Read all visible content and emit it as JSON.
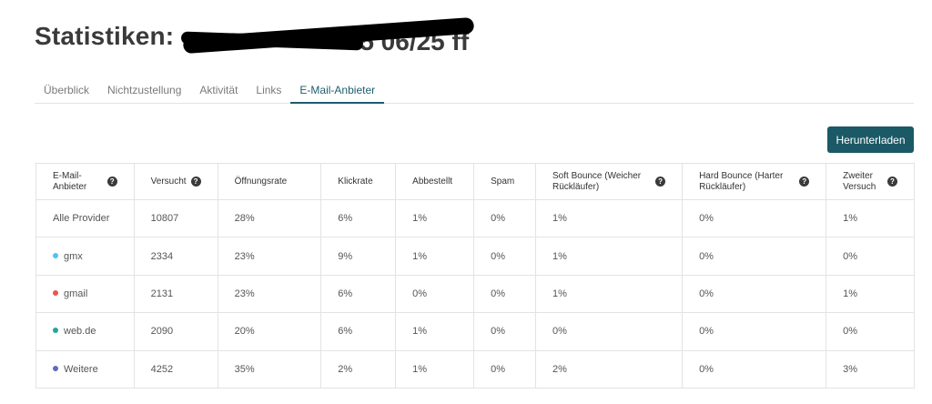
{
  "page": {
    "title": "Statistiken:",
    "title_redacted_tail": "",
    "redacted_visible": "5 06/25 ff"
  },
  "tabs": [
    {
      "label": "Überblick",
      "active": false
    },
    {
      "label": "Nichtzustellung",
      "active": false
    },
    {
      "label": "Aktivität",
      "active": false
    },
    {
      "label": "Links",
      "active": false
    },
    {
      "label": "E-Mail-Anbieter",
      "active": true
    }
  ],
  "toolbar": {
    "download_label": "Herunterladen"
  },
  "colors": {
    "accent": "#1b5966",
    "gmx": "#4fc3f7",
    "gmail": "#ef5350",
    "webde": "#26a69a",
    "weitere": "#5c6bc0"
  },
  "table": {
    "headers": [
      {
        "label": "E-Mail-Anbieter",
        "help": true
      },
      {
        "label": "Versucht",
        "help": true
      },
      {
        "label": "Öffnungsrate",
        "help": false
      },
      {
        "label": "Klickrate",
        "help": false
      },
      {
        "label": "Abbestellt",
        "help": false
      },
      {
        "label": "Spam",
        "help": false
      },
      {
        "label": "Soft Bounce (Weicher Rückläufer)",
        "help": true
      },
      {
        "label": "Hard Bounce (Harter Rückläufer)",
        "help": true
      },
      {
        "label": "Zweiter Versuch",
        "help": true
      }
    ],
    "rows": [
      {
        "provider": "Alle Provider",
        "dot": null,
        "versucht": "10807",
        "oeffnung": "28%",
        "klick": "6%",
        "abbestellt": "1%",
        "spam": "0%",
        "soft": "1%",
        "hard": "0%",
        "zweiter": "1%"
      },
      {
        "provider": "gmx",
        "dot": "#4fc3f7",
        "versucht": "2334",
        "oeffnung": "23%",
        "klick": "9%",
        "abbestellt": "1%",
        "spam": "0%",
        "soft": "1%",
        "hard": "0%",
        "zweiter": "0%"
      },
      {
        "provider": "gmail",
        "dot": "#ef5350",
        "versucht": "2131",
        "oeffnung": "23%",
        "klick": "6%",
        "abbestellt": "0%",
        "spam": "0%",
        "soft": "1%",
        "hard": "0%",
        "zweiter": "1%"
      },
      {
        "provider": "web.de",
        "dot": "#26a69a",
        "versucht": "2090",
        "oeffnung": "20%",
        "klick": "6%",
        "abbestellt": "1%",
        "spam": "0%",
        "soft": "0%",
        "hard": "0%",
        "zweiter": "0%"
      },
      {
        "provider": "Weitere",
        "dot": "#5c6bc0",
        "versucht": "4252",
        "oeffnung": "35%",
        "klick": "2%",
        "abbestellt": "1%",
        "spam": "0%",
        "soft": "2%",
        "hard": "0%",
        "zweiter": "3%"
      }
    ]
  },
  "icons": {
    "help": "question-circle-icon"
  }
}
